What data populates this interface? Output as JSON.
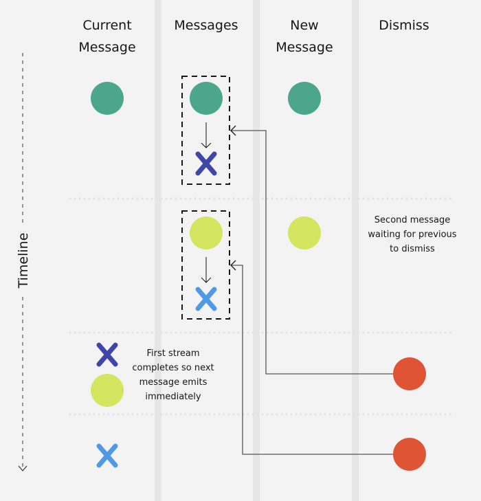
{
  "columns": [
    {
      "line1": "Current",
      "line2": "Message"
    },
    {
      "line1": "Messages",
      "line2": ""
    },
    {
      "line1": "New",
      "line2": "Message"
    },
    {
      "line1": "Dismiss",
      "line2": ""
    }
  ],
  "timeline_label": "Timeline",
  "notes": {
    "second_message": [
      "Second message",
      "waiting for previous",
      "to dismiss"
    ],
    "first_stream": [
      "First stream",
      "completes so next",
      "message emits",
      "immediately"
    ]
  },
  "colors": {
    "background": "#f3f3f3",
    "lane_divider": "#e6e6e6",
    "message_1": "#4ba68a",
    "message_2": "#d4e55f",
    "complete_1": "#3f46aa",
    "complete_2": "#4f9ae8",
    "dismiss": "#e05436"
  }
}
